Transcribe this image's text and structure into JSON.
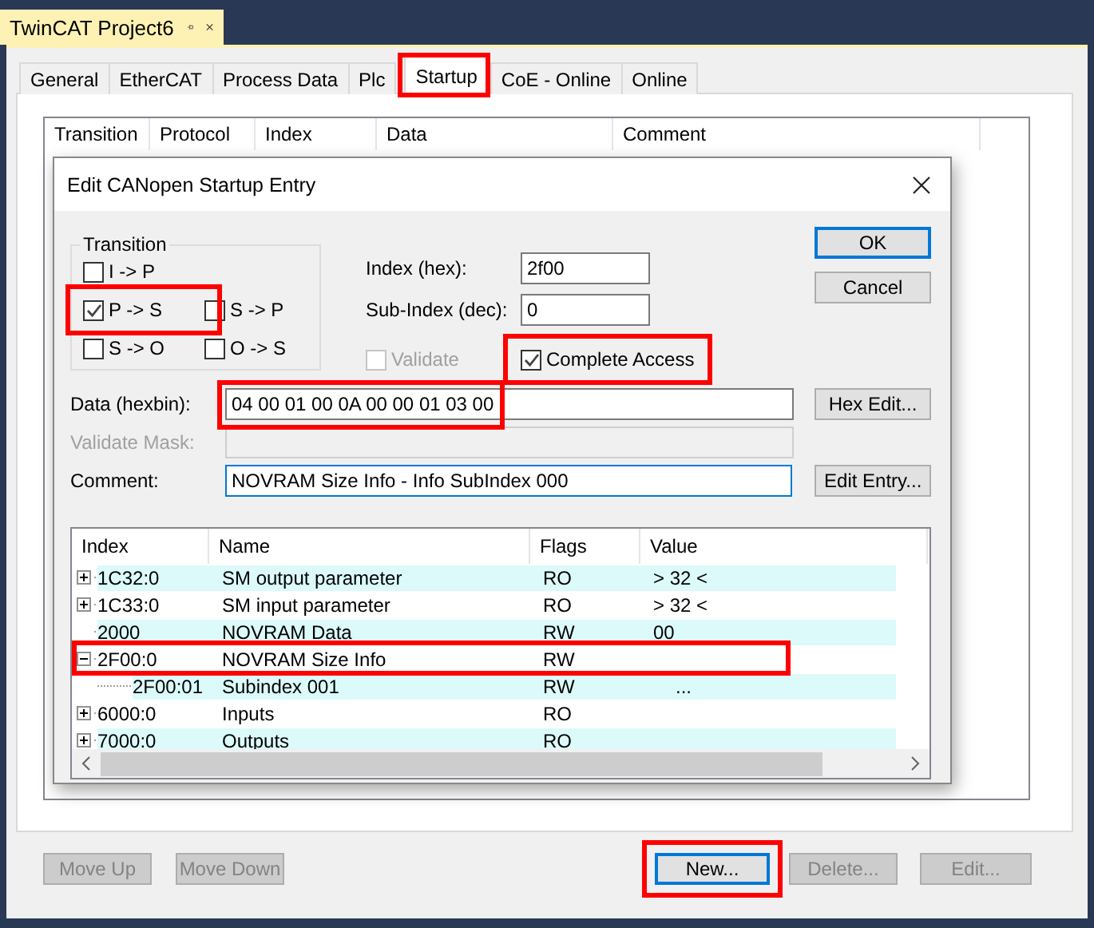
{
  "document_tab": {
    "title": "TwinCAT Project6"
  },
  "tabs": [
    {
      "label": "General",
      "selected": false,
      "highlighted": false
    },
    {
      "label": "EtherCAT",
      "selected": false,
      "highlighted": false
    },
    {
      "label": "Process Data",
      "selected": false,
      "highlighted": false
    },
    {
      "label": "Plc",
      "selected": false,
      "highlighted": false
    },
    {
      "label": "Startup",
      "selected": true,
      "highlighted": true
    },
    {
      "label": "CoE - Online",
      "selected": false,
      "highlighted": false
    },
    {
      "label": "Online",
      "selected": false,
      "highlighted": false
    }
  ],
  "startup_list": {
    "columns": [
      "Transition",
      "Protocol",
      "Index",
      "Data",
      "Comment"
    ]
  },
  "dialog": {
    "title": "Edit CANopen Startup Entry",
    "transition": {
      "label": "Transition",
      "options": [
        {
          "label": "I -> P",
          "checked": false,
          "highlighted": false
        },
        {
          "label": "P -> S",
          "checked": true,
          "highlighted": true
        },
        {
          "label": "S -> P",
          "checked": false,
          "highlighted": false
        },
        {
          "label": "S -> O",
          "checked": false,
          "highlighted": false
        },
        {
          "label": "O -> S",
          "checked": false,
          "highlighted": false
        }
      ]
    },
    "index": {
      "label": "Index (hex):",
      "value": "2f00"
    },
    "sub_index": {
      "label": "Sub-Index (dec):",
      "value": "0"
    },
    "validate": {
      "label": "Validate",
      "checked": false,
      "disabled": true,
      "highlighted": false
    },
    "complete_access": {
      "label": "Complete Access",
      "checked": true,
      "disabled": false,
      "highlighted": true
    },
    "ok_button": "OK",
    "cancel_button": "Cancel",
    "data": {
      "label": "Data (hexbin):",
      "value": "04 00 01 00 0A 00 00 01 03 00",
      "highlighted": true
    },
    "hex_edit_button": "Hex Edit...",
    "validate_mask": {
      "label": "Validate Mask:",
      "disabled": true
    },
    "comment": {
      "label": "Comment:",
      "value": "NOVRAM Size Info - Info SubIndex 000"
    },
    "edit_entry_button": "Edit Entry...",
    "object_list": {
      "columns": [
        "Index",
        "Name",
        "Flags",
        "Value"
      ],
      "rows": [
        {
          "index": "1C32:0",
          "name": "SM output parameter",
          "flags": "RO",
          "value": "> 32 <",
          "kind": "node",
          "expanded": false,
          "highlighted": false
        },
        {
          "index": "1C33:0",
          "name": "SM input parameter",
          "flags": "RO",
          "value": "> 32 <",
          "kind": "node",
          "expanded": false,
          "highlighted": false
        },
        {
          "index": "2000",
          "name": "NOVRAM Data",
          "flags": "RW",
          "value": "00",
          "kind": "leaf",
          "highlighted": false
        },
        {
          "index": "2F00:0",
          "name": "NOVRAM Size Info",
          "flags": "RW",
          "kind": "node",
          "expanded": true,
          "highlighted": true,
          "children": [
            {
              "index": "2F00:01",
              "name": "Subindex 001",
              "flags": "RW",
              "value": "...",
              "kind": "leaf",
              "highlighted": false
            }
          ]
        },
        {
          "index": "6000:0",
          "name": "Inputs",
          "flags": "RO",
          "kind": "node",
          "expanded": false,
          "highlighted": false
        },
        {
          "index": "7000:0",
          "name": "Outputs",
          "flags": "RO",
          "kind": "node",
          "expanded": false,
          "highlighted": false
        }
      ]
    }
  },
  "buttons": [
    {
      "label": "Move Up",
      "disabled": true,
      "default": false,
      "highlighted": false
    },
    {
      "label": "Move Down",
      "disabled": true,
      "default": false,
      "highlighted": false
    },
    {
      "label": "New...",
      "disabled": false,
      "default": true,
      "highlighted": true
    },
    {
      "label": "Delete...",
      "disabled": true,
      "default": false,
      "highlighted": false
    },
    {
      "label": "Edit...",
      "disabled": true,
      "default": false,
      "highlighted": false
    }
  ]
}
